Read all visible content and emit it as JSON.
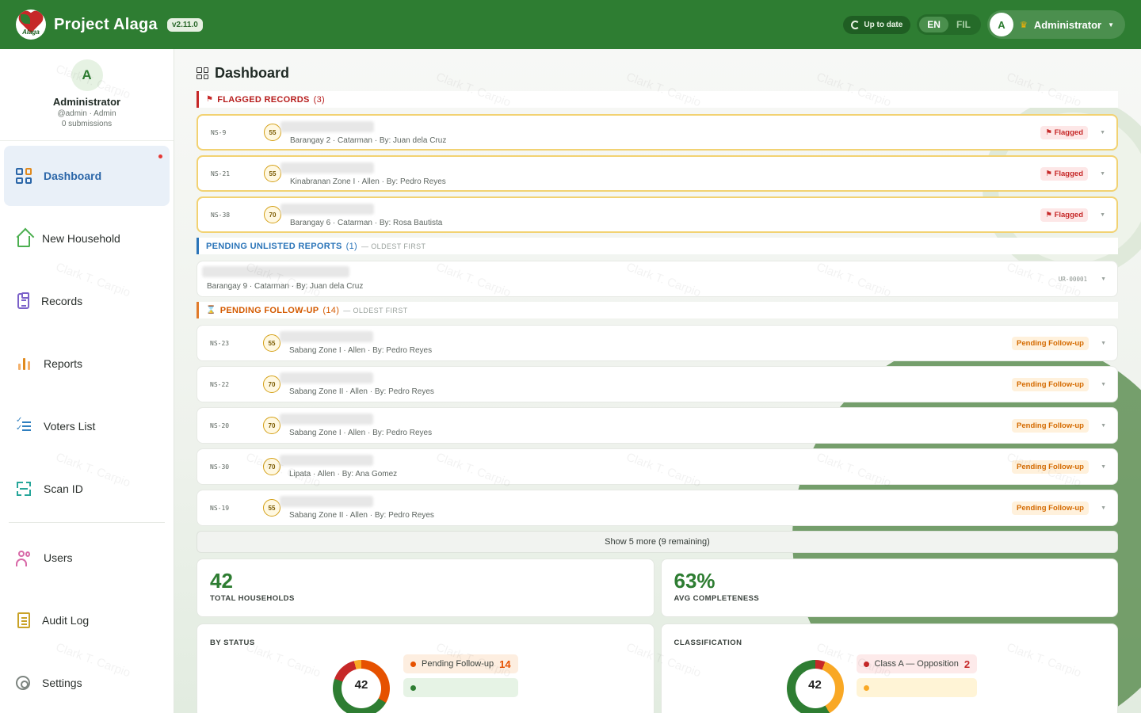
{
  "header": {
    "app_title": "Project Alaga",
    "logo_text": "Alaga",
    "version": "v2.11.0",
    "sync_status": "Up to date",
    "languages": [
      "EN",
      "FIL"
    ],
    "active_language": "EN",
    "user_initial": "A",
    "user_name": "Administrator"
  },
  "sidebar": {
    "profile": {
      "initial": "A",
      "name": "Administrator",
      "handle": "@admin · Admin",
      "submissions": "0 submissions"
    },
    "items": [
      {
        "label": "Dashboard",
        "icon": "dashboard-icon",
        "active": true
      },
      {
        "label": "New Household",
        "icon": "house-icon"
      },
      {
        "label": "Records",
        "icon": "clipboard-icon"
      },
      {
        "label": "Reports",
        "icon": "bar-chart-icon"
      },
      {
        "label": "Voters List",
        "icon": "checklist-icon"
      },
      {
        "label": "Scan ID",
        "icon": "scan-icon"
      },
      {
        "label": "Users",
        "icon": "users-icon"
      },
      {
        "label": "Audit Log",
        "icon": "scroll-icon"
      },
      {
        "label": "Settings",
        "icon": "gear-icon"
      }
    ]
  },
  "main": {
    "title": "Dashboard",
    "watermark": "Clark T. Carpio",
    "flagged": {
      "label": "FLAGGED RECORDS",
      "count": "(3)",
      "records": [
        {
          "id": "NS-9",
          "score": "55",
          "meta": "Barangay 2 · Catarman · By: Juan dela Cruz",
          "status": "Flagged"
        },
        {
          "id": "NS-21",
          "score": "55",
          "meta": "Kinabranan Zone I · Allen · By: Pedro Reyes",
          "status": "Flagged"
        },
        {
          "id": "NS-38",
          "score": "70",
          "meta": "Barangay 6 · Catarman · By: Rosa Bautista",
          "status": "Flagged"
        }
      ]
    },
    "unlisted": {
      "label": "PENDING UNLISTED REPORTS",
      "count": "(1)",
      "note": "— OLDEST FIRST",
      "records": [
        {
          "meta": "Barangay 9 · Catarman · By: Juan dela Cruz",
          "code": "UR-00001"
        }
      ]
    },
    "followup": {
      "label": "PENDING FOLLOW-UP",
      "count": "(14)",
      "note": "— OLDEST FIRST",
      "records": [
        {
          "id": "NS-23",
          "score": "55",
          "meta": "Sabang Zone I · Allen · By: Pedro Reyes",
          "status": "Pending Follow-up"
        },
        {
          "id": "NS-22",
          "score": "70",
          "meta": "Sabang Zone II · Allen · By: Pedro Reyes",
          "status": "Pending Follow-up"
        },
        {
          "id": "NS-20",
          "score": "70",
          "meta": "Sabang Zone I · Allen · By: Pedro Reyes",
          "status": "Pending Follow-up"
        },
        {
          "id": "NS-30",
          "score": "70",
          "meta": "Lipata · Allen · By: Ana Gomez",
          "status": "Pending Follow-up"
        },
        {
          "id": "NS-19",
          "score": "55",
          "meta": "Sabang Zone II · Allen · By: Pedro Reyes",
          "status": "Pending Follow-up"
        }
      ],
      "show_more": "Show 5 more (9 remaining)"
    },
    "stats": {
      "total_households": {
        "value": "42",
        "label": "TOTAL HOUSEHOLDS"
      },
      "avg_completeness": {
        "value": "63%",
        "label": "AVG COMPLETENESS"
      }
    },
    "by_status": {
      "title": "BY STATUS",
      "total": "42",
      "legend": [
        {
          "label": "Pending Follow-up",
          "count": "14",
          "color": "#e65100"
        }
      ]
    },
    "classification": {
      "title": "CLASSIFICATION",
      "total": "42",
      "legend": [
        {
          "label": "Class A — Opposition",
          "count": "2",
          "color": "#c62828"
        }
      ]
    }
  },
  "colors": {
    "brand": "#2e7d32",
    "flag": "#c62828",
    "pending": "#d46a00",
    "link_blue": "#2a74b8"
  }
}
